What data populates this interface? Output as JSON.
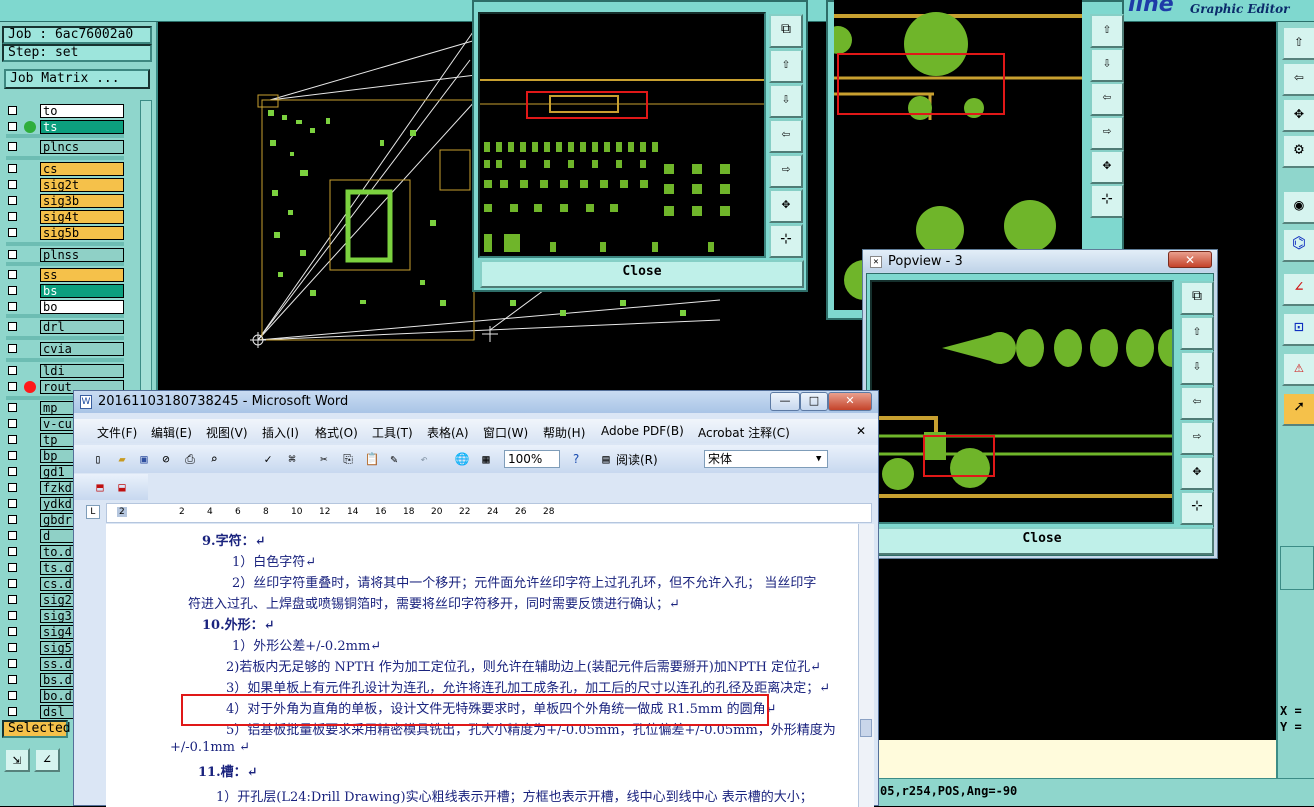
{
  "app": {
    "job_label": "Job : 6ac76002a0",
    "step_label": "Step: set",
    "job_matrix_button": "Job Matrix ...",
    "graphic_editor_title": "Graphic Editor",
    "logo_text": "line",
    "selected_label": "Selected",
    "coord_x": "X =",
    "coord_y": "Y =",
    "status_text": "05,r254,POS,Ang=-90"
  },
  "layers": [
    {
      "name": "to",
      "color": "white",
      "dot": ""
    },
    {
      "name": "ts",
      "color": "teal",
      "dot": "#2fae3b"
    },
    {
      "name": "plncs",
      "color": "gray",
      "dot": ""
    },
    {
      "name": "cs",
      "color": "orange",
      "dot": ""
    },
    {
      "name": "sig2t",
      "color": "orange",
      "dot": ""
    },
    {
      "name": "sig3b",
      "color": "orange",
      "dot": ""
    },
    {
      "name": "sig4t",
      "color": "orange",
      "dot": ""
    },
    {
      "name": "sig5b",
      "color": "orange",
      "dot": ""
    },
    {
      "name": "plnss",
      "color": "gray",
      "dot": ""
    },
    {
      "name": "ss",
      "color": "orange",
      "dot": ""
    },
    {
      "name": "bs",
      "color": "teal",
      "dot": ""
    },
    {
      "name": "bo",
      "color": "white",
      "dot": ""
    },
    {
      "name": "drl",
      "color": "gray",
      "dot": ""
    },
    {
      "name": "cvia",
      "color": "gray",
      "dot": ""
    },
    {
      "name": "ldi",
      "color": "gray",
      "dot": ""
    },
    {
      "name": "rout",
      "color": "gray",
      "dot": "#ff1a1a"
    },
    {
      "name": "mp",
      "color": "gray",
      "dot": ""
    },
    {
      "name": "v-cu",
      "color": "gray",
      "dot": ""
    },
    {
      "name": "tp",
      "color": "gray",
      "dot": ""
    },
    {
      "name": "bp",
      "color": "gray",
      "dot": ""
    },
    {
      "name": "gd1",
      "color": "gray",
      "dot": ""
    },
    {
      "name": "fzkd",
      "color": "gray",
      "dot": ""
    },
    {
      "name": "ydkd",
      "color": "gray",
      "dot": ""
    },
    {
      "name": "gbdr",
      "color": "gray",
      "dot": ""
    },
    {
      "name": "d",
      "color": "gray",
      "dot": ""
    },
    {
      "name": "to.d",
      "color": "gray",
      "dot": ""
    },
    {
      "name": "ts.d",
      "color": "gray",
      "dot": ""
    },
    {
      "name": "cs.d",
      "color": "gray",
      "dot": ""
    },
    {
      "name": "sig2",
      "color": "gray",
      "dot": ""
    },
    {
      "name": "sig3",
      "color": "gray",
      "dot": ""
    },
    {
      "name": "sig4",
      "color": "gray",
      "dot": ""
    },
    {
      "name": "sig5",
      "color": "gray",
      "dot": ""
    },
    {
      "name": "ss.d",
      "color": "gray",
      "dot": ""
    },
    {
      "name": "bs.d",
      "color": "gray",
      "dot": ""
    },
    {
      "name": "bo.d",
      "color": "gray",
      "dot": ""
    },
    {
      "name": "dsl",
      "color": "gray",
      "dot": ""
    }
  ],
  "popview1": {
    "close_label": "Close"
  },
  "popview3": {
    "title": "Popview - 3",
    "close_label": "Close",
    "close_glyph": "✕"
  },
  "word": {
    "title": "20161103180738245 - Microsoft Word",
    "title_buttons": [
      "—",
      "□",
      "✕"
    ],
    "menus": [
      "文件(F)",
      "编辑(E)",
      "视图(V)",
      "插入(I)",
      "格式(O)",
      "工具(T)",
      "表格(A)",
      "窗口(W)",
      "帮助(H)",
      "Adobe PDF(B)",
      "Acrobat 注释(C)"
    ],
    "menu_close": "✕",
    "zoom": "100%",
    "reading_label": "阅读(R)",
    "font_name": "宋体",
    "ruler_ticks": [
      "2",
      "2",
      "4",
      "6",
      "8",
      "10",
      "12",
      "14",
      "16",
      "18",
      "20",
      "22",
      "24",
      "26",
      "28"
    ],
    "lines": [
      "9.字符：↵",
      "1）白色字符↵",
      "2）丝印字符重叠时，请将其中一个移开；元件面允许丝印字符上过孔孔环，但不允许入孔；  当丝印字",
      "符进入过孔、上焊盘或喷锡铜箔时，需要将丝印字符移开，同时需要反馈进行确认；↵",
      "10.外形：↵",
      "1）外形公差+/-0.2mm↵",
      "2)若板内无足够的 NPTH 作为加工定位孔，则允许在辅助边上(装配元件后需要掰开)加NPTH 定位孔↵",
      "3）如果单板上有元件孔设计为连孔，允许将连孔加工成条孔，加工后的尺寸以连孔的孔径及距离决定；↵",
      "4）对于外角为直角的单板，设计文件无特殊要求时，单板四个外角统一做成 R1.5mm 的圆角↵",
      "5）铝基板批量板要求采用精密模具铣出，孔大小精度为+/-0.05mm，孔位偏差+/-0.05mm，外形精度为",
      "+/-0.1mm ↵",
      "11.槽：↵",
      "1）开孔层(L24:Drill Drawing)实心粗线表示开槽；方框也表示开槽，线中心到线中心 表示槽的大小；"
    ]
  },
  "colors": {
    "canvas_bg": "#000000",
    "panel_teal": "#8fd6cc",
    "pad_green": "#6fb52a",
    "trace_gold": "#c8a030",
    "highlight_red": "#e01818"
  }
}
